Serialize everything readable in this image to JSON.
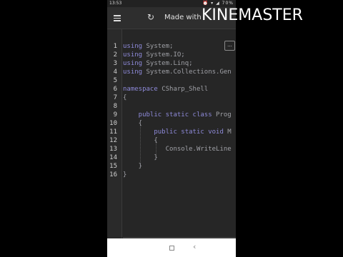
{
  "statusbar": {
    "time": "13:53",
    "battery": "70%"
  },
  "appbar": {
    "title": "Made with"
  },
  "watermark": {
    "part1": "KINE",
    "part2": "MASTER"
  },
  "editor": {
    "context_button": "...",
    "lines": [
      {
        "n": "1",
        "kw": "using",
        "rest": " System;"
      },
      {
        "n": "2",
        "kw": "using",
        "rest": " System.IO;"
      },
      {
        "n": "3",
        "kw": "using",
        "rest": " System.Linq;"
      },
      {
        "n": "4",
        "kw": "using",
        "rest": " System.Collections.Gen"
      },
      {
        "n": "5",
        "kw": "",
        "rest": ""
      },
      {
        "n": "6",
        "kw": "namespace",
        "rest": " CSharp_Shell"
      },
      {
        "n": "7",
        "kw": "",
        "rest": "{"
      },
      {
        "n": "8",
        "kw": "",
        "rest": ""
      },
      {
        "n": "9",
        "kw": "    public static class",
        "rest": " Prog"
      },
      {
        "n": "10",
        "kw": "",
        "rest": "    {"
      },
      {
        "n": "11",
        "kw": "        public static void",
        "rest": " M"
      },
      {
        "n": "12",
        "kw": "",
        "rest": "        {"
      },
      {
        "n": "13",
        "kw": "",
        "rest": "           Console.WriteLine"
      },
      {
        "n": "14",
        "kw": "",
        "rest": "        }"
      },
      {
        "n": "15",
        "kw": "",
        "rest": "    }"
      },
      {
        "n": "16",
        "kw": "",
        "rest": "}"
      }
    ]
  }
}
